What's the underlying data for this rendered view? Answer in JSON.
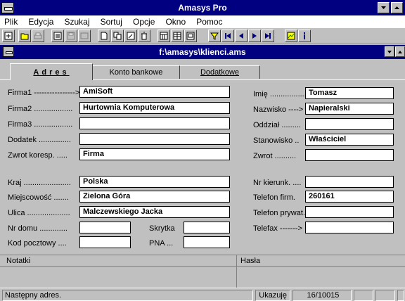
{
  "app": {
    "title": "Amasys Pro"
  },
  "menu": [
    {
      "label": "Plik"
    },
    {
      "label": "Edycja"
    },
    {
      "label": "Szukaj"
    },
    {
      "label": "Sortuj"
    },
    {
      "label": "Opcje"
    },
    {
      "label": "Okno"
    },
    {
      "label": "Pomoc"
    }
  ],
  "document": {
    "title": "f:\\amasys\\klienci.ams"
  },
  "tabs": [
    {
      "label": "Adres"
    },
    {
      "label": "Konto bankowe"
    },
    {
      "label": "Dodatkowe"
    }
  ],
  "form_left": [
    {
      "label": "Firma1 ---------------->",
      "value": "AmiSoft"
    },
    {
      "label": "Firma2 ..................",
      "value": "Hurtownia Komputerowa"
    },
    {
      "label": "Firma3 ..................",
      "value": ""
    },
    {
      "label": "Dodatek ...............",
      "value": ""
    },
    {
      "label": "Zwrot koresp. .....",
      "value": "Firma"
    },
    {
      "label": "Kraj ......................",
      "value": "Polska"
    },
    {
      "label": "Miejscowość .......",
      "value": "Zielona Góra"
    },
    {
      "label": "Ulica ....................",
      "value": "Malczewskiego Jacka"
    },
    {
      "label": "Nr domu .............",
      "value": ""
    },
    {
      "label": "Kod pocztowy ....",
      "value": ""
    }
  ],
  "form_mid": [
    {
      "label": "Skrytka",
      "value": ""
    },
    {
      "label": "PNA ...",
      "value": ""
    }
  ],
  "form_right": [
    {
      "label": "Imię ..................",
      "value": "Tomasz"
    },
    {
      "label": "Nazwisko ---->",
      "value": "Napieralski"
    },
    {
      "label": "Oddział .........",
      "value": ""
    },
    {
      "label": "Stanowisko ..",
      "value": "Właściciel"
    },
    {
      "label": "Zwrot ..........",
      "value": ""
    },
    {
      "label": "Nr kierunk. ....",
      "value": ""
    },
    {
      "label": "Telefon firm.",
      "value": "260161"
    },
    {
      "label": "Telefon prywat.",
      "value": ""
    },
    {
      "label": "Telefax ------->",
      "value": ""
    }
  ],
  "notes": {
    "left_label": "Notatki",
    "right_label": "Hasła"
  },
  "status": {
    "message": "Następny adres.",
    "mode": "Ukazuję",
    "record": "16/10015"
  }
}
